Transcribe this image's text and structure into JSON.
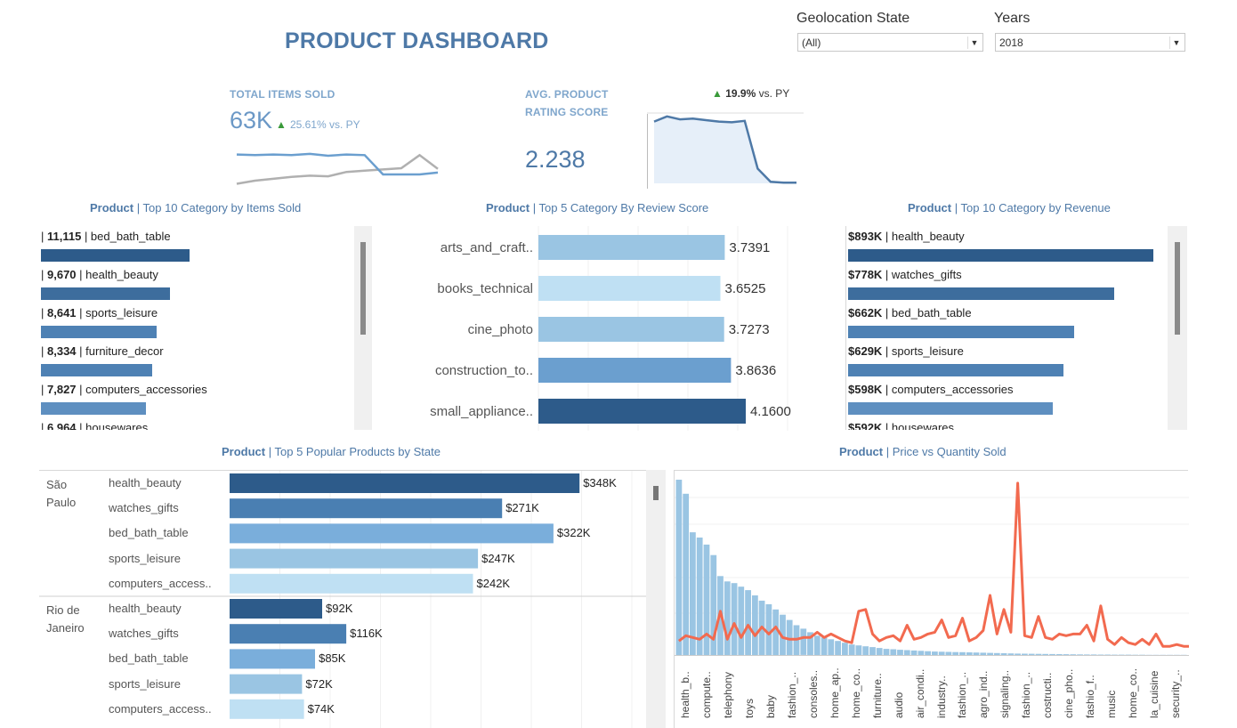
{
  "title": "PRODUCT DASHBOARD",
  "filters": {
    "state": {
      "label": "Geolocation State",
      "value": "(All)"
    },
    "years": {
      "label": "Years",
      "value": "2018"
    }
  },
  "kpi_items": {
    "label": "TOTAL ITEMS SOLD",
    "value": "63K",
    "delta": "25.61% vs. PY"
  },
  "kpi_rating": {
    "label_line1": "AVG. PRODUCT",
    "label_line2": "RATING SCORE",
    "value": "2.238",
    "delta_value": "19.9%",
    "delta_suffix": "vs. PY"
  },
  "colors": {
    "dark": "#2d5b8a",
    "mid": "#4e81b4",
    "light": "#9ac5e3",
    "lighter": "#bfe0f3",
    "line": "#f26a4f",
    "spark_current": "#6b9fcf",
    "spark_prev": "#b0b0b0"
  },
  "items_sold": {
    "title_bold": "Product",
    "title_rest": "| Top 10 Category by Items Sold",
    "rows": [
      {
        "value": "11,115",
        "name": "bed_bath_table"
      },
      {
        "value": "9,670",
        "name": "health_beauty"
      },
      {
        "value": "8,641",
        "name": "sports_leisure"
      },
      {
        "value": "8,334",
        "name": "furniture_decor"
      },
      {
        "value": "7,827",
        "name": "computers_accessories"
      },
      {
        "value": "6,964",
        "name": "housewares"
      }
    ]
  },
  "review": {
    "title_bold": "Product",
    "title_rest": "| Top 5  Category By Review Score",
    "rows": [
      {
        "name": "arts_and_craft..",
        "value": "3.7391"
      },
      {
        "name": "books_technical",
        "value": "3.6525"
      },
      {
        "name": "cine_photo",
        "value": "3.7273"
      },
      {
        "name": "construction_to..",
        "value": "3.8636"
      },
      {
        "name": "small_appliance..",
        "value": "4.1600"
      }
    ]
  },
  "revenue": {
    "title_bold": "Product",
    "title_rest": "| Top 10 Category by Revenue",
    "rows": [
      {
        "value": "$893K",
        "name": "health_beauty"
      },
      {
        "value": "$778K",
        "name": "watches_gifts"
      },
      {
        "value": "$662K",
        "name": "bed_bath_table"
      },
      {
        "value": "$629K",
        "name": "sports_leisure"
      },
      {
        "value": "$598K",
        "name": "computers_accessories"
      },
      {
        "value": "$592K",
        "name": "housewares"
      }
    ]
  },
  "popular": {
    "title_bold": "Product",
    "title_rest": "| Top 5 Popular Products by State",
    "groups": [
      {
        "state_line1": "São",
        "state_line2": "Paulo",
        "rows": [
          {
            "name": "health_beauty",
            "value": "$348K"
          },
          {
            "name": "watches_gifts",
            "value": "$271K"
          },
          {
            "name": "bed_bath_table",
            "value": "$322K"
          },
          {
            "name": "sports_leisure",
            "value": "$247K"
          },
          {
            "name": "computers_access..",
            "value": "$242K"
          }
        ]
      },
      {
        "state_line1": "Rio de",
        "state_line2": "Janeiro",
        "rows": [
          {
            "name": "health_beauty",
            "value": "$92K"
          },
          {
            "name": "watches_gifts",
            "value": "$116K"
          },
          {
            "name": "bed_bath_table",
            "value": "$85K"
          },
          {
            "name": "sports_leisure",
            "value": "$72K"
          },
          {
            "name": "computers_access..",
            "value": "$74K"
          }
        ]
      }
    ]
  },
  "price_qty": {
    "title_bold": "Product",
    "title_rest": "| Price vs Quantity Sold",
    "x_labels": [
      "health_b..",
      "compute..",
      "telephony",
      "toys",
      "baby",
      "fashion_..",
      "consoles..",
      "home_ap..",
      "home_co..",
      "furniture..",
      "audio",
      "air_condi..",
      "industry..",
      "fashion_..",
      "agro_ind..",
      "signaling..",
      "fashion_..",
      "costructi..",
      "cine_pho..",
      "fashio_f..",
      "music",
      "home_co..",
      "la_cuisine",
      "security_.."
    ]
  },
  "chart_data": [
    {
      "type": "bar",
      "title": "Top 10 Category by Items Sold",
      "categories": [
        "bed_bath_table",
        "health_beauty",
        "sports_leisure",
        "furniture_decor",
        "computers_accessories",
        "housewares"
      ],
      "values": [
        11115,
        9670,
        8641,
        8334,
        7827,
        6964
      ]
    },
    {
      "type": "bar",
      "title": "Top 5  Category By Review Score",
      "categories": [
        "arts_and_craft..",
        "books_technical",
        "cine_photo",
        "construction_to..",
        "small_appliance.."
      ],
      "values": [
        3.7391,
        3.6525,
        3.7273,
        3.8636,
        4.16
      ],
      "xlim": [
        0,
        5
      ]
    },
    {
      "type": "bar",
      "title": "Top 10 Category by Revenue",
      "categories": [
        "health_beauty",
        "watches_gifts",
        "bed_bath_table",
        "sports_leisure",
        "computers_accessories",
        "housewares"
      ],
      "values": [
        893,
        778,
        662,
        629,
        598,
        592
      ]
    },
    {
      "type": "bar",
      "title": "Top 5 Popular Products by State",
      "categories": [
        "health_beauty",
        "watches_gifts",
        "bed_bath_table",
        "sports_leisure",
        "computers_access.."
      ],
      "series": [
        {
          "name": "São Paulo",
          "values": [
            348,
            271,
            322,
            247,
            242
          ]
        },
        {
          "name": "Rio de Janeiro",
          "values": [
            92,
            116,
            85,
            72,
            74
          ]
        }
      ],
      "xlim": [
        0,
        400
      ]
    },
    {
      "type": "line",
      "title": "Total Items Sold trend",
      "series": [
        {
          "values": [
            5.2,
            5.1,
            5.2,
            5.1,
            5.3,
            5.0,
            5.2,
            5.1,
            2.0,
            2.0,
            2.0,
            2.3
          ]
        },
        {
          "values": [
            0.5,
            1.0,
            1.3,
            1.6,
            1.8,
            1.7,
            2.4,
            2.6,
            2.8,
            3.0,
            5.1,
            2.9
          ]
        }
      ]
    },
    {
      "type": "area",
      "title": "Avg. Product Rating Score trend",
      "values": [
        4.2,
        4.55,
        4.35,
        4.4,
        4.3,
        4.2,
        4.15,
        4.25,
        1.0,
        0.1,
        0.05,
        0.05
      ]
    },
    {
      "type": "bar",
      "title": "Price vs Quantity Sold",
      "bars": [
        100,
        92,
        70,
        67,
        63,
        57,
        45,
        42,
        41,
        39,
        37,
        34,
        31,
        29,
        26,
        23,
        20,
        17,
        15,
        13,
        11,
        10,
        9,
        8,
        7,
        6,
        5.5,
        5,
        4.5,
        4,
        3.5,
        3.3,
        3,
        2.8,
        2.6,
        2.4,
        2.2,
        2,
        1.9,
        1.8,
        1.7,
        1.6,
        1.5,
        1.4,
        1.3,
        1.2,
        1.1,
        1,
        0.9,
        0.8,
        0.75,
        0.7,
        0.65,
        0.6,
        0.55,
        0.5,
        0.45,
        0.4,
        0.35,
        0.3,
        0.28,
        0.26,
        0.24,
        0.22,
        0.2,
        0.18,
        0.16,
        0.14,
        0.12,
        0.1,
        0.1,
        0.1,
        0.1,
        0.1
      ],
      "line": [
        8,
        11,
        10,
        9,
        12,
        9,
        25,
        9,
        18,
        10,
        17,
        11,
        16,
        12,
        16,
        10,
        9,
        9,
        10,
        10,
        13,
        10,
        12,
        10,
        8,
        7,
        25,
        26,
        12,
        8,
        10,
        11,
        8,
        17,
        9,
        10,
        12,
        13,
        20,
        10,
        11,
        21,
        8,
        10,
        14,
        34,
        12,
        26,
        13,
        98,
        11,
        10,
        22,
        10,
        9,
        12,
        11,
        12,
        12,
        17,
        8,
        28,
        9,
        6,
        10,
        7,
        6,
        9,
        6,
        12,
        5,
        5,
        6,
        5,
        5
      ]
    }
  ]
}
